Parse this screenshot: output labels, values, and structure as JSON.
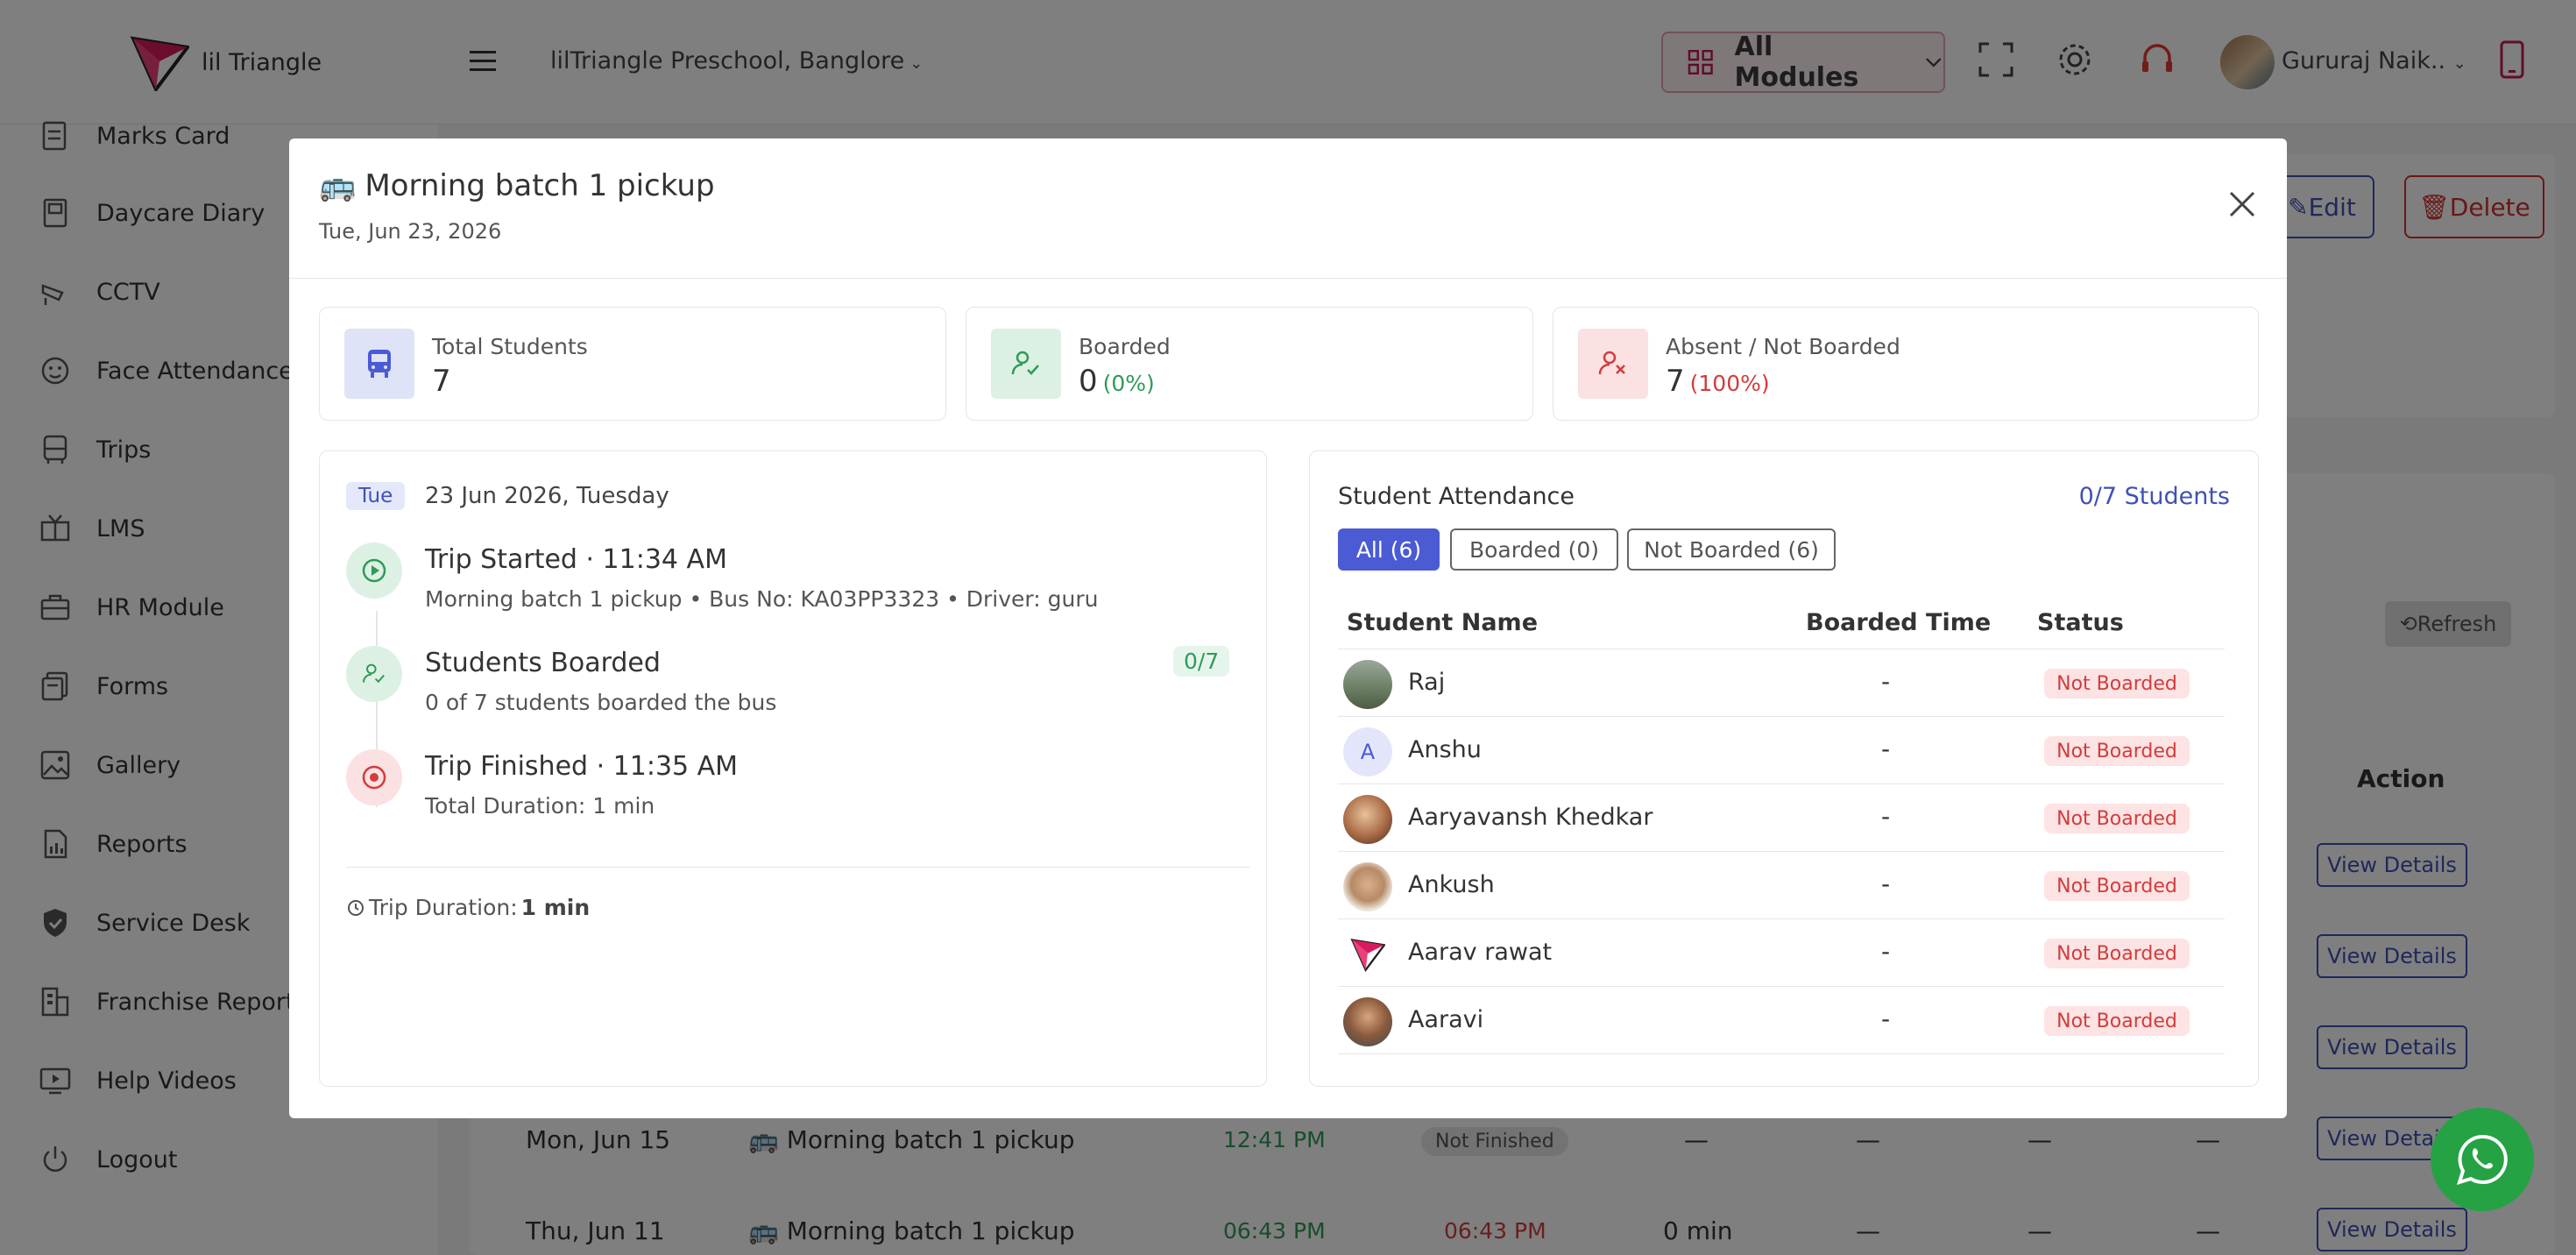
{
  "app": {
    "logo_text": "lil Triangle",
    "school": "lilTriangle Preschool, Banglore",
    "modules_label": "All Modules",
    "user_name": "Gururaj Naik..",
    "accent": "#3f51b5",
    "brand": "#c2185b"
  },
  "sidebar": {
    "items": [
      {
        "label": "Marks Card",
        "icon": "marks-card-icon"
      },
      {
        "label": "Daycare Diary",
        "icon": "diary-icon"
      },
      {
        "label": "CCTV",
        "icon": "cctv-icon"
      },
      {
        "label": "Face Attendance",
        "icon": "face-icon"
      },
      {
        "label": "Trips",
        "icon": "bus-icon"
      },
      {
        "label": "LMS",
        "icon": "lms-icon"
      },
      {
        "label": "HR Module",
        "icon": "briefcase-icon"
      },
      {
        "label": "Forms",
        "icon": "forms-icon"
      },
      {
        "label": "Gallery",
        "icon": "gallery-icon"
      },
      {
        "label": "Reports",
        "icon": "reports-icon"
      },
      {
        "label": "Service Desk",
        "icon": "shield-icon"
      },
      {
        "label": "Franchise Reports",
        "icon": "franchise-icon"
      },
      {
        "label": "Help Videos",
        "icon": "video-icon"
      },
      {
        "label": "Logout",
        "icon": "power-icon"
      }
    ]
  },
  "background": {
    "edit_label": "Edit",
    "delete_label": "Delete",
    "refresh_label": "Refresh",
    "action_header": "Action",
    "view_details_label": "View Details",
    "rows": [
      {
        "date": "Mon, Jun 15",
        "trip": "Morning batch 1 pickup",
        "start": "12:41 PM",
        "end": "Not Finished",
        "duration": "—",
        "c1": "—",
        "c2": "—",
        "c3": "—"
      },
      {
        "date": "Thu, Jun 11",
        "trip": "Morning batch 1 pickup",
        "start": "06:43 PM",
        "end": "06:43 PM",
        "duration": "0 min",
        "c1": "—",
        "c2": "—",
        "c3": "—"
      }
    ]
  },
  "modal": {
    "title": "Morning batch 1 pickup",
    "date": "Tue, Jun 23, 2026",
    "stats": {
      "total": {
        "label": "Total Students",
        "value": "7"
      },
      "boarded": {
        "label": "Boarded",
        "value": "0",
        "pct": "(0%)"
      },
      "absent": {
        "label": "Absent / Not Boarded",
        "value": "7",
        "pct": "(100%)"
      }
    },
    "timeline": {
      "day_pill": "Tue",
      "day_text": "23 Jun 2026, Tuesday",
      "started_title": "Trip Started · 11:34 AM",
      "started_sub": "Morning batch 1 pickup • Bus No: KA03PP3323 • Driver: guru",
      "boarded_title": "Students Boarded",
      "boarded_sub": "0 of 7 students boarded the bus",
      "boarded_count": "0/7",
      "finished_title": "Trip Finished · 11:35 AM",
      "finished_sub": "Total Duration: 1 min",
      "duration_label": "Trip Duration:",
      "duration_value": "1 min"
    },
    "attendance": {
      "title": "Student Attendance",
      "count": "0/7 Students",
      "filters": [
        "All (6)",
        "Boarded (0)",
        "Not Boarded (6)"
      ],
      "columns": [
        "Student Name",
        "Boarded Time",
        "Status"
      ],
      "students": [
        {
          "name": "Raj",
          "time": "-",
          "status": "Not Boarded",
          "avatar": "photo"
        },
        {
          "name": "Anshu",
          "time": "-",
          "status": "Not Boarded",
          "avatar": "A"
        },
        {
          "name": "Aaryavansh Khedkar",
          "time": "-",
          "status": "Not Boarded",
          "avatar": "photo"
        },
        {
          "name": "Ankush",
          "time": "-",
          "status": "Not Boarded",
          "avatar": "photo"
        },
        {
          "name": "Aarav rawat",
          "time": "-",
          "status": "Not Boarded",
          "avatar": "logo"
        },
        {
          "name": "Aaravi",
          "time": "-",
          "status": "Not Boarded",
          "avatar": "photo"
        }
      ]
    }
  }
}
